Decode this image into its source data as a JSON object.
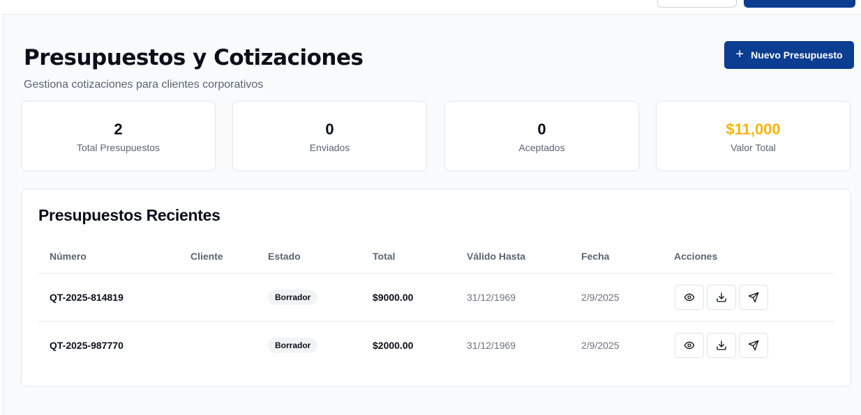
{
  "header": {
    "title": "Presupuestos y Cotizaciones",
    "subtitle": "Gestiona cotizaciones para clientes corporativos",
    "new_button": {
      "icon": "plus-icon",
      "label": "Nuevo Presupuesto"
    }
  },
  "stats": [
    {
      "value": "2",
      "label": "Total Presupuestos"
    },
    {
      "value": "0",
      "label": "Enviados"
    },
    {
      "value": "0",
      "label": "Aceptados"
    },
    {
      "value": "$11,000",
      "label": "Valor Total",
      "color": "#f5b50a"
    }
  ],
  "table": {
    "title": "Presupuestos Recientes",
    "columns": [
      "Número",
      "Cliente",
      "Estado",
      "Total",
      "Válido Hasta",
      "Fecha",
      "Acciones"
    ],
    "rows": [
      {
        "numero": "QT-2025-814819",
        "cliente": "",
        "estado": "Borrador",
        "total": "$9000.00",
        "valido_hasta": "31/12/1969",
        "fecha": "2/9/2025",
        "actions": [
          "eye-icon",
          "download-icon",
          "send-icon"
        ]
      },
      {
        "numero": "QT-2025-987770",
        "cliente": "",
        "estado": "Borrador",
        "total": "$2000.00",
        "valido_hasta": "31/12/1969",
        "fecha": "2/9/2025",
        "actions": [
          "eye-icon",
          "download-icon",
          "send-icon"
        ]
      }
    ]
  },
  "colors": {
    "primary": "#0b3d91",
    "accent": "#f5b50a"
  }
}
